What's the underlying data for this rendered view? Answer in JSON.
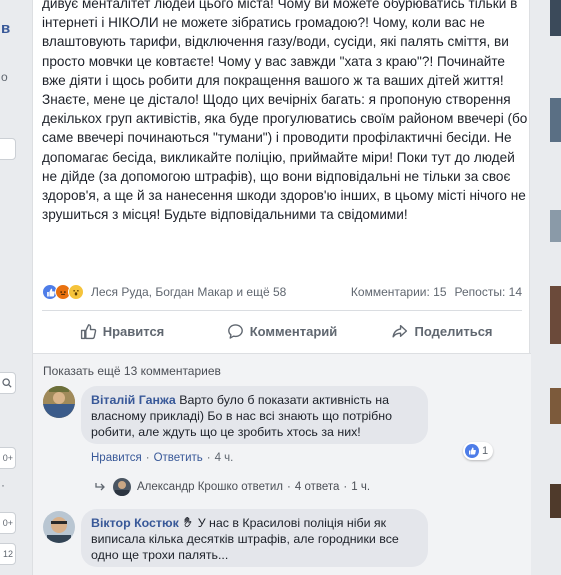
{
  "left_strip": {
    "item1": "в",
    "item2": "о",
    "badge1": "0+",
    "badge2": "0+",
    "badge3": "12"
  },
  "post": {
    "paragraphs": [
      "дивує менталітет людей цього міста! Чому ви можете обурюватись тільки в інтернеті і НІКОЛИ не можете зібратись громадою?! Чому, коли вас не влаштовують тарифи, відключення газу/води, сусіди, які палять сміття, ви просто мовчки це ковтаєте! Чому у вас завжди \"хата з краю\"?! Починайте вже діяти і щось робити для покращення вашого ж та ваших дітей життя!",
      "Знаєте, мене це дістало! Щодо цих вечірніх багать: я пропоную створення декількох груп активістів, яка буде прогулюватись своїм районом ввечері (бо саме ввечері починаються \"тумани\") і проводити профілактичні бесіди. Не допомагає бесіда, викликайте поліцію, приймайте міри! Поки тут до людей не дійде (за допомогою штрафів), що вони відповідальні не тільки за своє здоров'я, а ще й за нанесення шкоди здоров'ю інших, в цьому місті нічого не зрушиться з місця! Будьте відповідальними та свідомими!"
    ]
  },
  "reactions": {
    "names": "Леся Руда, Богдан Макар и ещё 58",
    "comments": "Комментарии: 15",
    "reposts": "Репосты: 14",
    "colors": {
      "like": "#4e7de8",
      "angry": "#e9710f",
      "wow": "#f5c33b"
    }
  },
  "actions": {
    "like": "Нравится",
    "comment": "Комментарий",
    "share": "Поделиться"
  },
  "comments": {
    "show_more": "Показать ещё 13 комментариев",
    "items": [
      {
        "author": "Віталій Ганжа",
        "text": "Варто було б показати активність на власному прикладі) Бо в нас всі знають що потрібно робити, але ждуть що це зробить хтось за них!",
        "like": "Нравится",
        "reply": "Ответить",
        "time": "4 ч.",
        "likes": "1"
      },
      {
        "author": "Віктор Костюк",
        "text": "У нас в Красилові поліція ніби як виписала кілька десятків штрафів, але городники все одно ще трохи палять..."
      }
    ],
    "reply_summary": {
      "author_replied": "Александр Крошко ответил",
      "count": "4 ответа",
      "time": "1 ч."
    }
  }
}
